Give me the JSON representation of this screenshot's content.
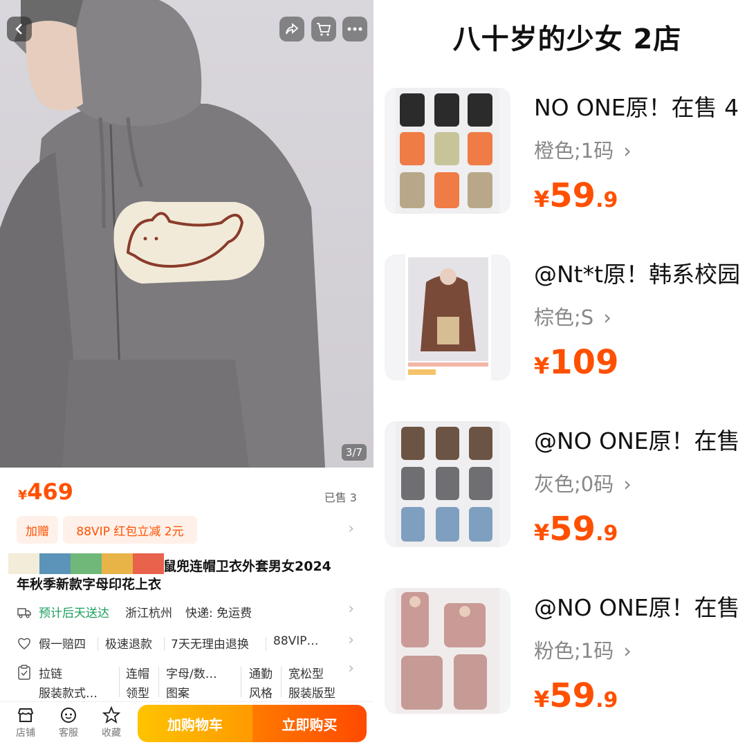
{
  "left": {
    "hero": {
      "counter": "3/7"
    },
    "price": {
      "symbol": "¥",
      "value": "469"
    },
    "sold": "已售 3",
    "promo_tags": [
      "加赠",
      "88VIP 红包立减 2元"
    ],
    "title": {
      "line1": "鼠兜连帽卫衣外套男女2024",
      "line2": "年秋季新款字母印花上衣",
      "swatch_colors": [
        "#f3ecd9",
        "#5c93b8",
        "#6fb87a",
        "#e8b448",
        "#e8624c"
      ]
    },
    "delivery": {
      "eta": "预计后天送达",
      "origin": "浙江杭州",
      "shipping": "快递: 免运费"
    },
    "guarantees": [
      "假一赔四",
      "极速退款",
      "7天无理由退换",
      "88VIP…"
    ],
    "params": {
      "col1": [
        "拉链",
        "服装款式…"
      ],
      "col2": [
        "连帽",
        "领型"
      ],
      "col3": [
        "字母/数…",
        "图案"
      ],
      "col4": [
        "通勤",
        "风格"
      ],
      "col5": [
        "宽松型",
        "服装版型"
      ]
    },
    "bottom_nav": [
      "店铺",
      "客服",
      "收藏"
    ],
    "add_to_cart": "加购物车",
    "buy_now": "立即购买"
  },
  "right": {
    "store_name": "八十岁的少女 2店",
    "products": [
      {
        "title": "NO ONE原！在售 4",
        "variant": "橙色;1码",
        "price_symbol": "¥",
        "price_int": "59",
        "price_dec": ".9"
      },
      {
        "title": "@Nt*t原！韩系校园",
        "variant": "棕色;S",
        "price_symbol": "¥",
        "price_int": "109",
        "price_dec": ""
      },
      {
        "title": "@NO ONE原！在售",
        "variant": "灰色;0码",
        "price_symbol": "¥",
        "price_int": "59",
        "price_dec": ".9"
      },
      {
        "title": "@NO ONE原！在售",
        "variant": "粉色;1码",
        "price_symbol": "¥",
        "price_int": "59",
        "price_dec": ".9"
      }
    ]
  },
  "colors": {
    "accent": "#ff5000",
    "green": "#19a05a"
  }
}
